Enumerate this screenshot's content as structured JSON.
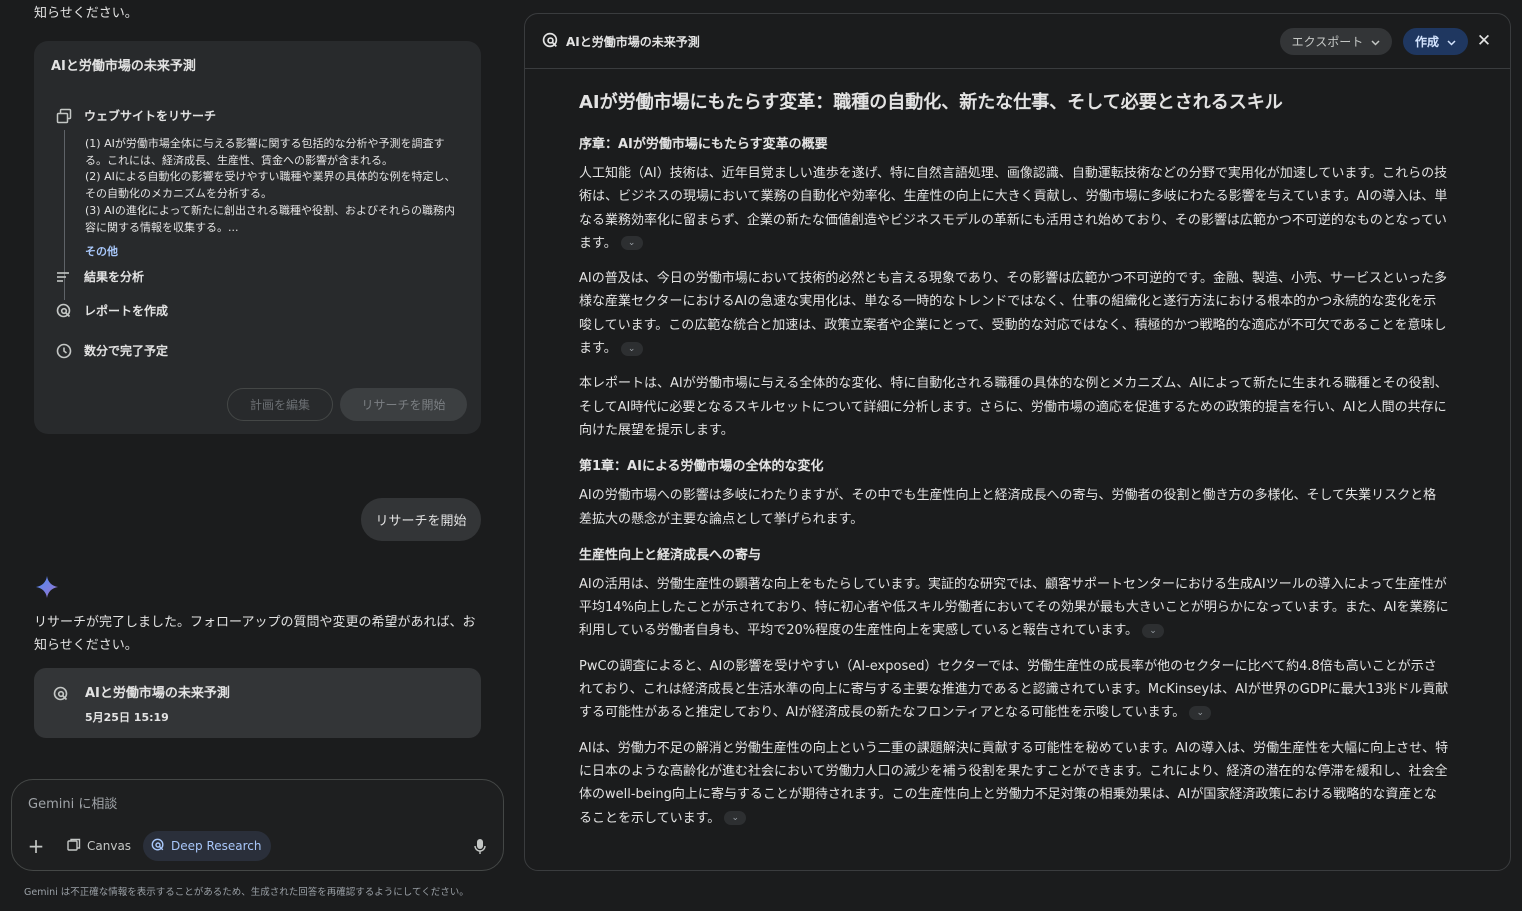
{
  "chat": {
    "cut_text": "知らせください。",
    "plan_card": {
      "title": "AIと労働市場の未来予測",
      "step_research": "ウェブサイトをリサーチ",
      "research_items": [
        "(1) AIが労働市場全体に与える影響に関する包括的な分析や予測を調査する。これには、経済成長、生産性、賃金への影響が含まれる。",
        "(2) AIによる自動化の影響を受けやすい職種や業界の具体的な例を特定し、その自動化のメカニズムを分析する。",
        "(3) AIの進化によって新たに創出される職種や役割、およびそれらの職務内容に関する情報を収集する。..."
      ],
      "more_label": "その他",
      "step_analyze": "結果を分析",
      "step_report": "レポートを作成",
      "step_eta": "数分で完了予定",
      "edit_plan_label": "計画を編集",
      "start_research_label": "リサーチを開始"
    },
    "user_message": "リサーチを開始",
    "assistant_message": "リサーチが完了しました。フォローアップの質問や変更の希望があれば、お知らせください。",
    "report_card": {
      "title": "AIと労働市場の未来予測",
      "date": "5月25日 15:19"
    },
    "input": {
      "placeholder": "Gemini に相談",
      "canvas_label": "Canvas",
      "deep_research_label": "Deep Research"
    },
    "disclaimer": "Gemini は不正確な情報を表示することがあるため、生成された回答を再確認するようにしてください。"
  },
  "panel": {
    "title": "AIと労働市場の未来予測",
    "export_label": "エクスポート",
    "create_label": "作成",
    "doc": {
      "h1": "AIが労働市場にもたらす変革：職種の自動化、新たな仕事、そして必要とされるスキル",
      "intro_heading": "序章：AIが労働市場にもたらす変革の概要",
      "intro_p1": "人工知能（AI）技術は、近年目覚ましい進歩を遂げ、特に自然言語処理、画像認識、自動運転技術などの分野で実用化が加速しています。これらの技術は、ビジネスの現場において業務の自動化や効率化、生産性の向上に大きく貢献し、労働市場に多岐にわたる影響を与えています。AIの導入は、単なる業務効率化に留まらず、企業の新たな価値創造やビジネスモデルの革新にも活用され始めており、その影響は広範かつ不可逆的なものとなっています。",
      "intro_p2": "AIの普及は、今日の労働市場において技術的必然とも言える現象であり、その影響は広範かつ不可逆的です。金融、製造、小売、サービスといった多様な産業セクターにおけるAIの急速な実用化は、単なる一時的なトレンドではなく、仕事の組織化と遂行方法における根本的かつ永続的な変化を示唆しています。この広範な統合と加速は、政策立案者や企業にとって、受動的な対応ではなく、積極的かつ戦略的な適応が不可欠であることを意味します。",
      "intro_p3": "本レポートは、AIが労働市場に与える全体的な変化、特に自動化される職種の具体的な例とメカニズム、AIによって新たに生まれる職種とその役割、そしてAI時代に必要となるスキルセットについて詳細に分析します。さらに、労働市場の適応を促進するための政策的提言を行い、AIと人間の共存に向けた展望を提示します。",
      "ch1_heading": "第1章：AIによる労働市場の全体的な変化",
      "ch1_p1": "AIの労働市場への影響は多岐にわたりますが、その中でも生産性向上と経済成長への寄与、労働者の役割と働き方の多様化、そして失業リスクと格差拡大の懸念が主要な論点として挙げられます。",
      "sub_heading": "生産性向上と経済成長への寄与",
      "sub_p1": "AIの活用は、労働生産性の顕著な向上をもたらしています。実証的な研究では、顧客サポートセンターにおける生成AIツールの導入によって生産性が平均14%向上したことが示されており、特に初心者や低スキル労働者においてその効果が最も大きいことが明らかになっています。また、AIを業務に利用している労働者自身も、平均で20%程度の生産性向上を実感していると報告されています。",
      "sub_p2": "PwCの調査によると、AIの影響を受けやすい（AI-exposed）セクターでは、労働生産性の成長率が他のセクターに比べて約4.8倍も高いことが示されており、これは経済成長と生活水準の向上に寄与する主要な推進力であると認識されています。McKinseyは、AIが世界のGDPに最大13兆ドル貢献する可能性があると推定しており、AIが経済成長の新たなフロンティアとなる可能性を示唆しています。",
      "sub_p3": "AIは、労働力不足の解消と労働生産性の向上という二重の課題解決に貢献する可能性を秘めています。AIの導入は、労働生産性を大幅に向上させ、特に日本のような高齢化が進む社会において労働力人口の減少を補う役割を果たすことができます。これにより、経済の潜在的な停滞を緩和し、社会全体のwell-being向上に寄与することが期待されます。この生産性向上と労働力不足対策の相乗効果は、AIが国家経済政策における戦略的な資産となることを示しています。"
    }
  }
}
